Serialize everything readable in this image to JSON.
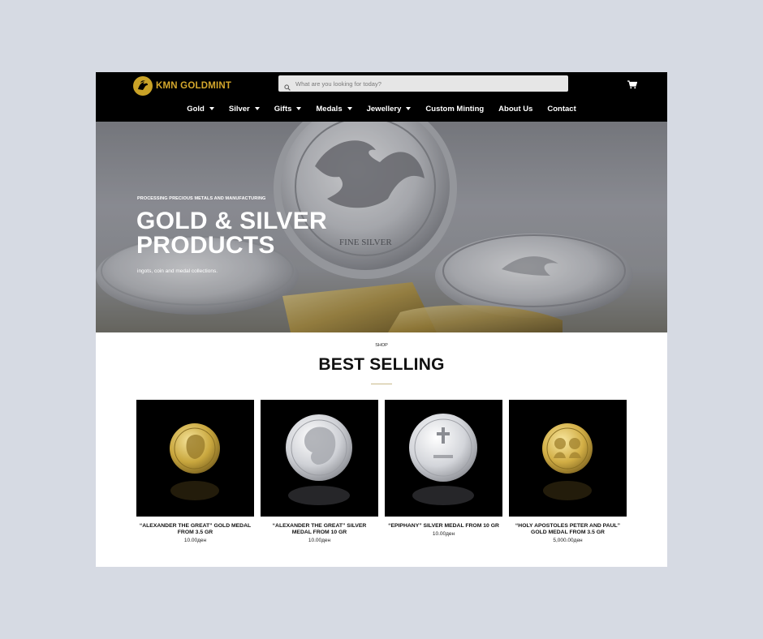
{
  "brand": {
    "name": "KMN GOLDMINT",
    "color": "#d4a72c"
  },
  "search": {
    "placeholder": "What are you looking for today?"
  },
  "nav": {
    "items": [
      {
        "label": "Gold",
        "dropdown": true
      },
      {
        "label": "Silver",
        "dropdown": true
      },
      {
        "label": "Gifts",
        "dropdown": true
      },
      {
        "label": "Medals",
        "dropdown": true
      },
      {
        "label": "Jewellery",
        "dropdown": true
      },
      {
        "label": "Custom Minting",
        "dropdown": false
      },
      {
        "label": "About Us",
        "dropdown": false
      },
      {
        "label": "Contact",
        "dropdown": false
      }
    ]
  },
  "hero": {
    "eyebrow": "PROCESSING PRECIOUS METALS AND MANUFACTURING",
    "title_line1": "GOLD & SILVER",
    "title_line2": "PRODUCTS",
    "subtitle": "ingots, coin and medal collections.",
    "coin_inscription": "FINE SILVER"
  },
  "section": {
    "eyebrow": "SHOP",
    "title": "BEST SELLING"
  },
  "products": [
    {
      "name": "“ALEXANDER THE GREAT” GOLD MEDAL FROM 3.5 GR",
      "price": "10.00ден",
      "metal": "gold"
    },
    {
      "name": "“ALEXANDER THE GREAT” SILVER MEDAL FROM 10 GR",
      "price": "10.00ден",
      "metal": "silver"
    },
    {
      "name": "“EPIPHANY” SILVER MEDAL FROM 10 GR",
      "price": "10.00ден",
      "metal": "silver"
    },
    {
      "name": "“HOLY APOSTOLES PETER AND PAUL” GOLD MEDAL FROM 3.5 GR",
      "price": "5,000.00ден",
      "metal": "gold"
    }
  ],
  "icons": {
    "search": "search-icon",
    "cart": "cart-icon",
    "logo": "pegasus-logo-icon"
  },
  "colors": {
    "header_bg": "#000000",
    "page_bg": "#d6dae3",
    "accent": "#d4a72c"
  }
}
